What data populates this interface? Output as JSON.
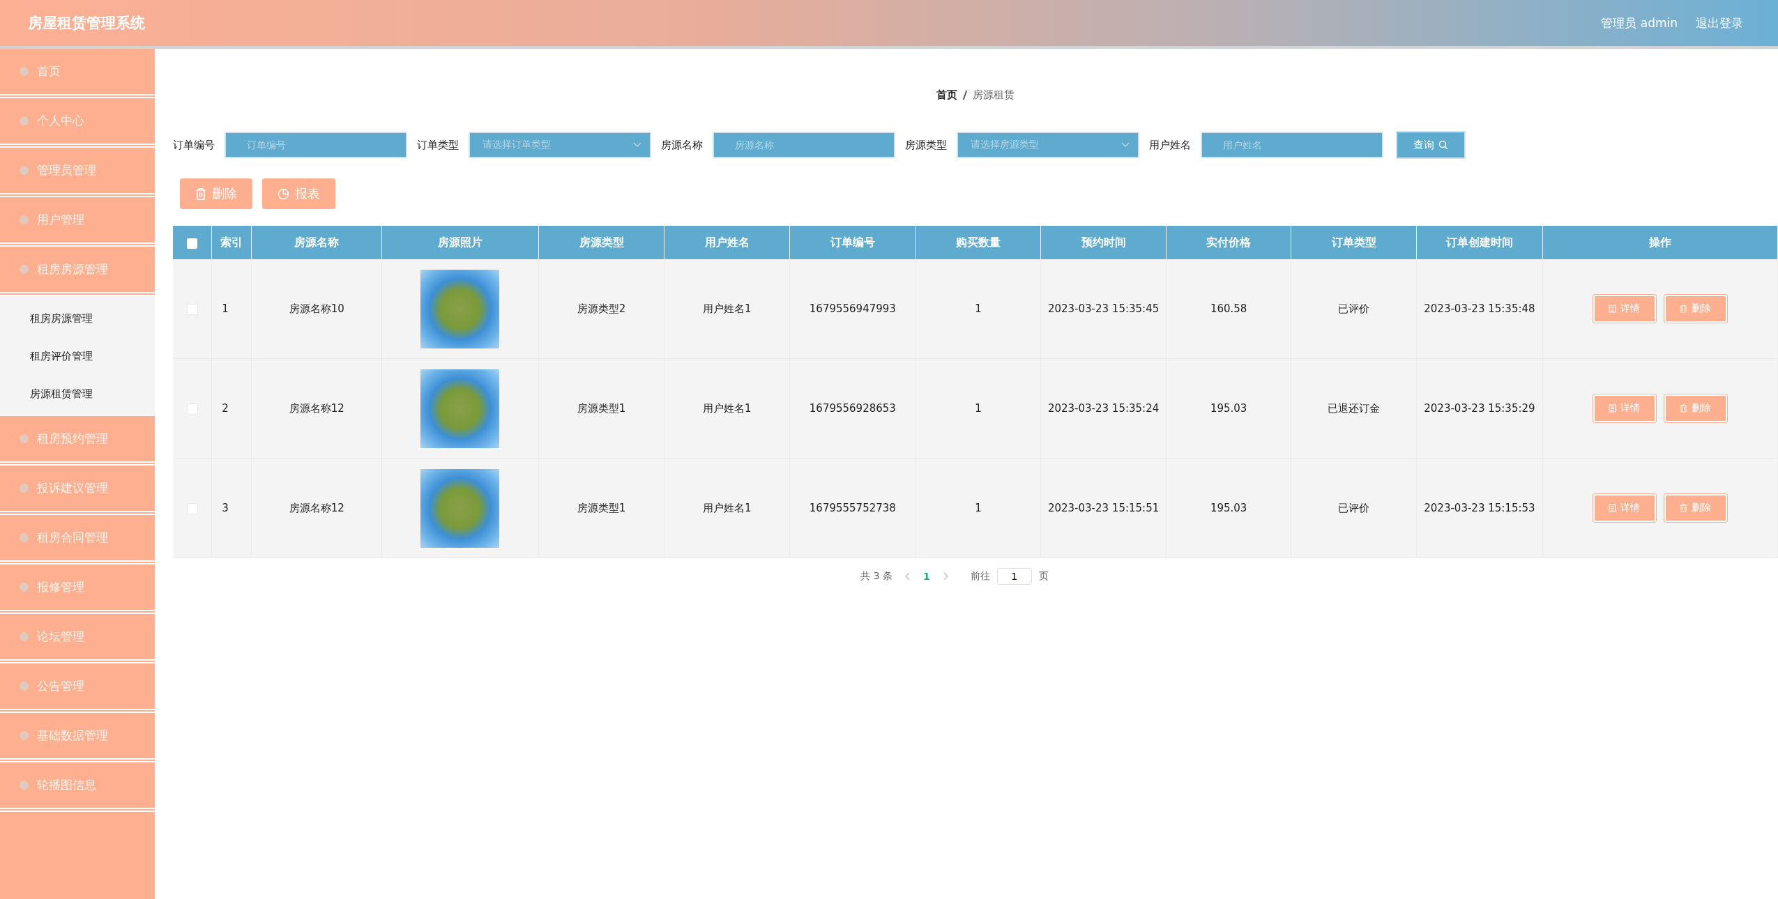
{
  "header": {
    "title": "房屋租赁管理系统",
    "user": "管理员 admin",
    "logout": "退出登录"
  },
  "sidebar": {
    "items": [
      {
        "label": "首页"
      },
      {
        "label": "个人中心"
      },
      {
        "label": "管理员管理"
      },
      {
        "label": "用户管理"
      },
      {
        "label": "租房房源管理",
        "children": [
          {
            "label": "租房房源管理"
          },
          {
            "label": "租房评价管理"
          },
          {
            "label": "房源租赁管理"
          }
        ]
      },
      {
        "label": "租房预约管理"
      },
      {
        "label": "投诉建议管理"
      },
      {
        "label": "租房合同管理"
      },
      {
        "label": "报修管理"
      },
      {
        "label": "论坛管理"
      },
      {
        "label": "公告管理"
      },
      {
        "label": "基础数据管理"
      },
      {
        "label": "轮播图信息"
      }
    ]
  },
  "breadcrumb": [
    "首页",
    "房源租赁"
  ],
  "filters": [
    {
      "kind": "input",
      "label": "订单编号",
      "placeholder": "订单编号"
    },
    {
      "kind": "select",
      "label": "订单类型",
      "placeholder": "请选择订单类型"
    },
    {
      "kind": "input",
      "label": "房源名称",
      "placeholder": "房源名称"
    },
    {
      "kind": "select",
      "label": "房源类型",
      "placeholder": "请选择房源类型"
    },
    {
      "kind": "input",
      "label": "用户姓名",
      "placeholder": "用户姓名"
    }
  ],
  "search_button": "查询",
  "actions": [
    {
      "kind": "delete",
      "label": "删除"
    },
    {
      "kind": "report",
      "label": "报表"
    }
  ],
  "table": {
    "select_all_checked": false,
    "columns": [
      {
        "label": "索引",
        "kind": "text"
      },
      {
        "label": "房源名称",
        "kind": "text"
      },
      {
        "label": "房源照片",
        "kind": "image"
      },
      {
        "label": "房源类型",
        "kind": "text"
      },
      {
        "label": "用户姓名",
        "kind": "text"
      },
      {
        "label": "订单编号",
        "kind": "text"
      },
      {
        "label": "购买数量",
        "kind": "text"
      },
      {
        "label": "预约时间",
        "kind": "text"
      },
      {
        "label": "实付价格",
        "kind": "text"
      },
      {
        "label": "订单类型",
        "kind": "text"
      },
      {
        "label": "订单创建时间",
        "kind": "text"
      },
      {
        "label": "操作",
        "kind": "actions"
      }
    ],
    "rows": [
      {
        "checked": false,
        "cells": [
          "1",
          "房源名称10",
          "",
          "房源类型2",
          "用户姓名1",
          "1679556947993",
          "1",
          "2023-03-23 15:35:45",
          "160.58",
          "已评价",
          "2023-03-23 15:35:48"
        ],
        "buttons": [
          "详情",
          "删除"
        ]
      },
      {
        "checked": false,
        "cells": [
          "2",
          "房源名称12",
          "",
          "房源类型1",
          "用户姓名1",
          "1679556928653",
          "1",
          "2023-03-23 15:35:24",
          "195.03",
          "已退还订金",
          "2023-03-23 15:35:29"
        ],
        "buttons": [
          "详情",
          "删除"
        ]
      },
      {
        "checked": false,
        "cells": [
          "3",
          "房源名称12",
          "",
          "房源类型1",
          "用户姓名1",
          "1679555752738",
          "1",
          "2023-03-23 15:15:51",
          "195.03",
          "已评价",
          "2023-03-23 15:15:53"
        ],
        "buttons": [
          "详情",
          "删除"
        ]
      }
    ]
  },
  "pagination": {
    "total": "共 3 条",
    "pages": [
      {
        "label": "1",
        "selected": true
      }
    ],
    "goto_label": "前往",
    "goto_value": "1",
    "page_suffix": "页"
  }
}
